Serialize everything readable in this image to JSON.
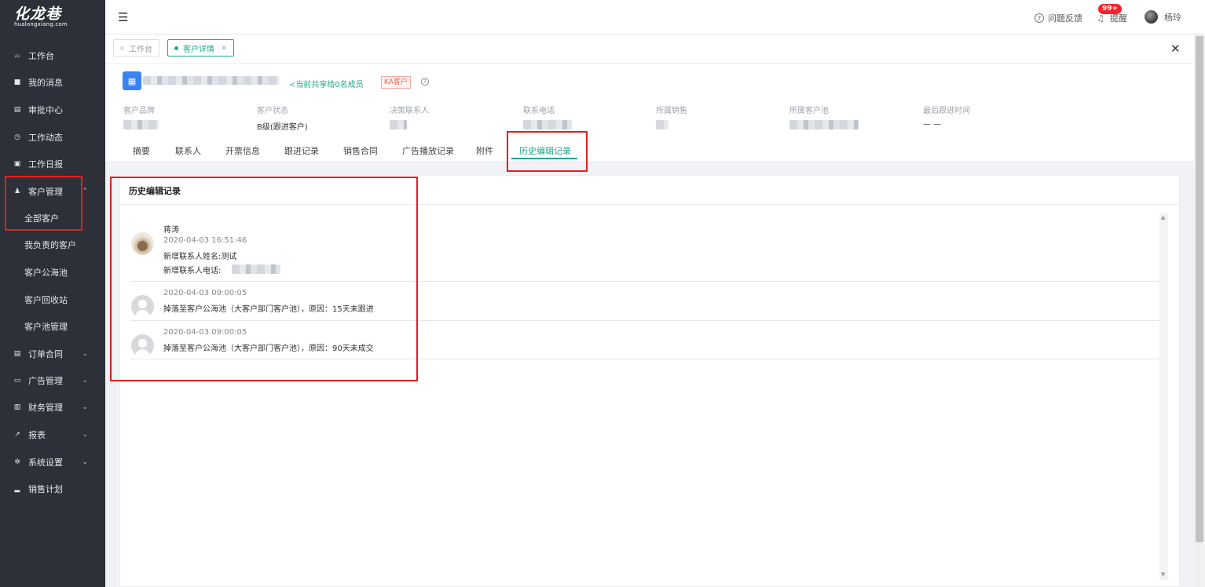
{
  "app": {
    "logo_text": "化龙巷",
    "logo_sub": "hualongxiang.com"
  },
  "sidebar": {
    "items": [
      {
        "label": "工作台",
        "icon": "dashboard-icon",
        "glyph": "⌓"
      },
      {
        "label": "我的消息",
        "icon": "message-icon",
        "glyph": "■"
      },
      {
        "label": "审批中心",
        "icon": "approval-icon",
        "glyph": "▤"
      },
      {
        "label": "工作动态",
        "icon": "clock-icon",
        "glyph": "◷"
      },
      {
        "label": "工作日报",
        "icon": "calendar-icon",
        "glyph": "▣"
      },
      {
        "label": "客户管理",
        "icon": "customers-icon",
        "glyph": "♟",
        "expanded": true
      },
      {
        "label": "订单合同",
        "icon": "order-icon",
        "glyph": "▤"
      },
      {
        "label": "广告管理",
        "icon": "ad-icon",
        "glyph": "▭"
      },
      {
        "label": "财务管理",
        "icon": "finance-icon",
        "glyph": "▥"
      },
      {
        "label": "报表",
        "icon": "report-icon",
        "glyph": "↗"
      },
      {
        "label": "系统设置",
        "icon": "settings-icon",
        "glyph": "✲"
      },
      {
        "label": "销售计划",
        "icon": "sales-plan-icon",
        "glyph": "▂"
      }
    ],
    "sub_items": [
      "全部客户",
      "我负责的客户",
      "客户公海池",
      "客户回收站",
      "客户池管理"
    ]
  },
  "header": {
    "menu_icon": "hamburger-icon",
    "feedback_label": "问题反馈",
    "remind_label": "提醒",
    "badge": "99+",
    "username": "杨玲"
  },
  "tags": [
    {
      "label": "工作台",
      "active": false
    },
    {
      "label": "客户详情",
      "active": true
    }
  ],
  "customer": {
    "share_text": "当前共享给0名成员",
    "ka_badge": "KA客户",
    "fields": [
      {
        "label": "客户品牌",
        "value": ""
      },
      {
        "label": "客户状态",
        "value": "B级(跟进客户)"
      },
      {
        "label": "决策联系人",
        "value": ""
      },
      {
        "label": "联系电话",
        "value": ""
      },
      {
        "label": "所属销售",
        "value": ""
      },
      {
        "label": "所属客户池",
        "value": ""
      },
      {
        "label": "最后跟进时间",
        "value": "— —"
      }
    ],
    "tabs": [
      "摘要",
      "联系人",
      "开票信息",
      "跟进记录",
      "销售合同",
      "广告播放记录",
      "附件",
      "历史编辑记录"
    ],
    "active_tab": "历史编辑记录"
  },
  "history": {
    "title": "历史编辑记录",
    "entries": [
      {
        "author": "蒋涛",
        "time": "2020-04-03 16:51:46",
        "lines": [
          "新增联系人姓名:测试",
          "新增联系人电话:"
        ]
      },
      {
        "author": "",
        "time": "2020-04-03 09:00:05",
        "lines": [
          "掉落至客户公海池（大客户部门客户池），原因：15天未跟进"
        ]
      },
      {
        "author": "",
        "time": "2020-04-03 09:00:05",
        "lines": [
          "掉落至客户公海池（大客户部门客户池），原因：90天未成交"
        ]
      }
    ]
  },
  "colors": {
    "accent": "#1ca88c",
    "sidebar_bg": "#2d3038",
    "highlight_box": "#e02020",
    "badge": "#f5222d"
  }
}
